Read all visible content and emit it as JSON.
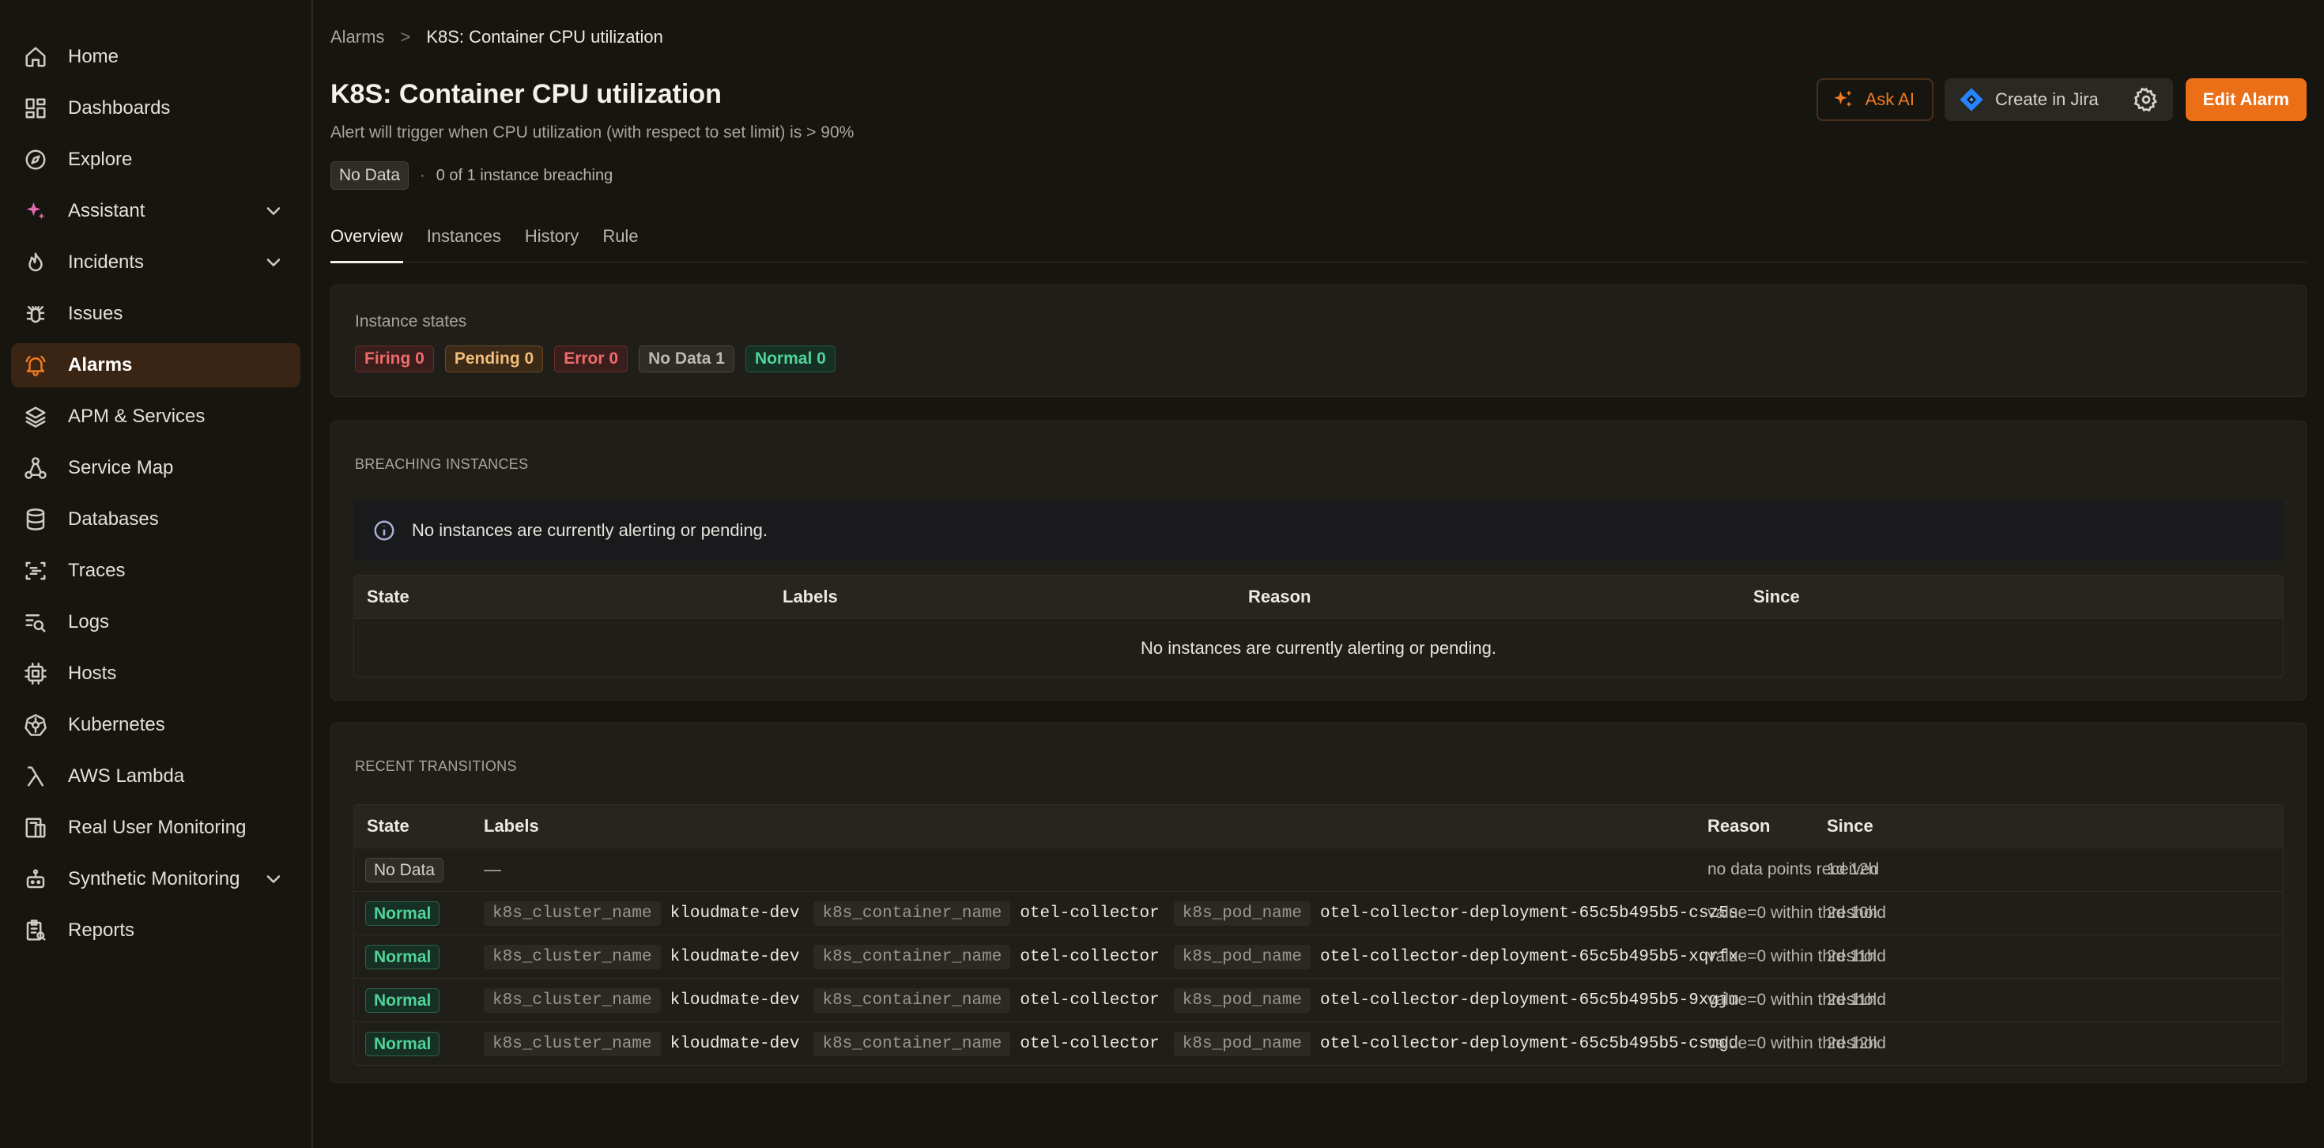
{
  "sidebar": {
    "items": [
      {
        "label": "Home",
        "icon": "home-icon"
      },
      {
        "label": "Dashboards",
        "icon": "dashboard-icon"
      },
      {
        "label": "Explore",
        "icon": "compass-icon"
      },
      {
        "label": "Assistant",
        "icon": "sparkle-icon",
        "expandable": true
      },
      {
        "label": "Incidents",
        "icon": "flame-icon",
        "expandable": true
      },
      {
        "label": "Issues",
        "icon": "bug-icon"
      },
      {
        "label": "Alarms",
        "icon": "bell-icon",
        "active": true
      },
      {
        "label": "APM & Services",
        "icon": "layers-icon"
      },
      {
        "label": "Service Map",
        "icon": "network-icon"
      },
      {
        "label": "Databases",
        "icon": "database-icon"
      },
      {
        "label": "Traces",
        "icon": "trace-icon"
      },
      {
        "label": "Logs",
        "icon": "logs-search-icon"
      },
      {
        "label": "Hosts",
        "icon": "cpu-icon"
      },
      {
        "label": "Kubernetes",
        "icon": "kubernetes-icon"
      },
      {
        "label": "AWS Lambda",
        "icon": "lambda-icon"
      },
      {
        "label": "Real User Monitoring",
        "icon": "devices-icon"
      },
      {
        "label": "Synthetic Monitoring",
        "icon": "robot-icon",
        "expandable": true
      },
      {
        "label": "Reports",
        "icon": "report-icon"
      }
    ]
  },
  "breadcrumb": {
    "parent": "Alarms",
    "separator": ">",
    "current": "K8S: Container CPU utilization"
  },
  "header": {
    "title": "K8S: Container CPU utilization",
    "subtitle": "Alert will trigger when CPU utilization (with respect to set limit) is > 90%",
    "status": "No Data",
    "dot": "·",
    "breaching": "0 of 1 instance breaching"
  },
  "actions": {
    "ask_ai": "Ask AI",
    "create_jira": "Create in Jira",
    "edit": "Edit Alarm"
  },
  "tabs": [
    "Overview",
    "Instances",
    "History",
    "Rule"
  ],
  "instance_states": {
    "label": "Instance states",
    "chips": [
      "Firing 0",
      "Pending 0",
      "Error 0",
      "No Data 1",
      "Normal 0"
    ]
  },
  "breaching": {
    "title": "BREACHING INSTANCES",
    "info": "No instances are currently alerting or pending.",
    "columns": [
      "State",
      "Labels",
      "Reason",
      "Since"
    ],
    "empty": "No instances are currently alerting or pending."
  },
  "recent": {
    "title": "RECENT TRANSITIONS",
    "columns": [
      "State",
      "Labels",
      "Reason",
      "Since"
    ],
    "rows": [
      {
        "state": "No Data",
        "labels": "—",
        "reason": "no data points received",
        "since": "1d 12h"
      },
      {
        "state": "Normal",
        "k1": "k8s_cluster_name",
        "v1": "kloudmate-dev",
        "k2": "k8s_container_name",
        "v2": "otel-collector",
        "k3": "k8s_pod_name",
        "v3": "otel-collector-deployment-65c5b495b5-csz5s",
        "reason": "value=0 within threshold",
        "since": "2d 10h"
      },
      {
        "state": "Normal",
        "k1": "k8s_cluster_name",
        "v1": "kloudmate-dev",
        "k2": "k8s_container_name",
        "v2": "otel-collector",
        "k3": "k8s_pod_name",
        "v3": "otel-collector-deployment-65c5b495b5-xqrfx",
        "reason": "value=0 within threshold",
        "since": "2d 11h"
      },
      {
        "state": "Normal",
        "k1": "k8s_cluster_name",
        "v1": "kloudmate-dev",
        "k2": "k8s_container_name",
        "v2": "otel-collector",
        "k3": "k8s_pod_name",
        "v3": "otel-collector-deployment-65c5b495b5-9xgjm",
        "reason": "value=0 within threshold",
        "since": "2d 11h"
      },
      {
        "state": "Normal",
        "k1": "k8s_cluster_name",
        "v1": "kloudmate-dev",
        "k2": "k8s_container_name",
        "v2": "otel-collector",
        "k3": "k8s_pod_name",
        "v3": "otel-collector-deployment-65c5b495b5-csmgd",
        "reason": "value=0 within threshold",
        "since": "2d 12h"
      }
    ]
  },
  "colors": {
    "accent": "#ea6f16",
    "background": "#161510",
    "panel": "#1f1e19",
    "normal": "#4fd49a",
    "firing": "#ee6b6b",
    "pending": "#f2bd79"
  }
}
